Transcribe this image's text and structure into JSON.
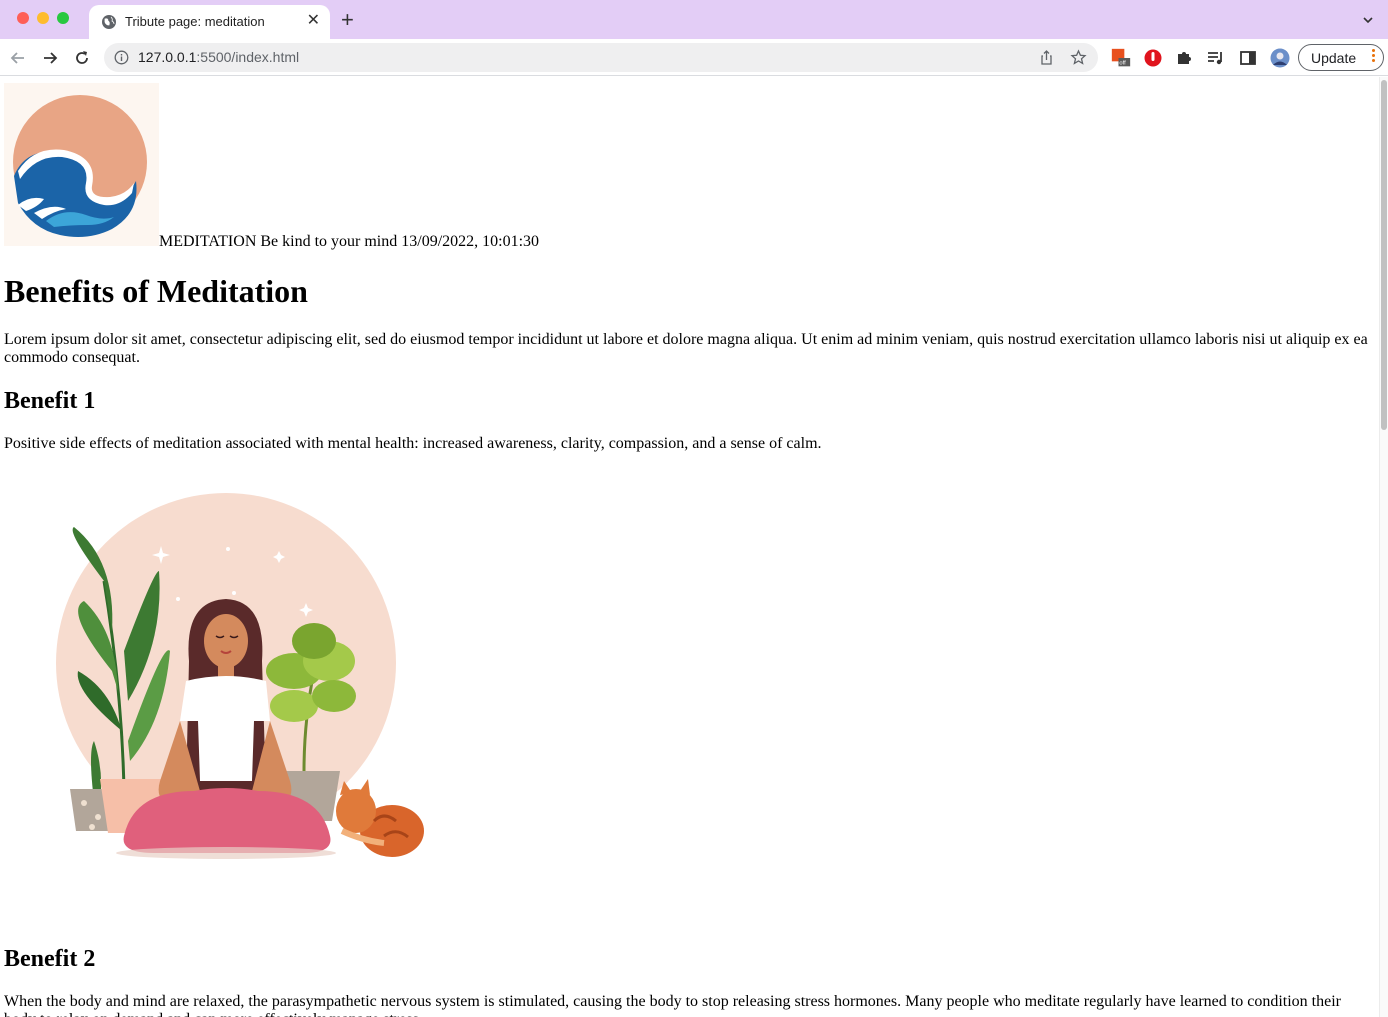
{
  "browser": {
    "tab_title": "Tribute page: meditation",
    "url_host": "127.0.0.1",
    "url_rest": ":5500/index.html",
    "update_label": "Update",
    "extension_badge": "off",
    "accent_color": "#e3cdf6"
  },
  "header": {
    "logo_alt": "meditation logo",
    "text": "MEDITATION Be kind to your mind 13/09/2022, 10:01:30"
  },
  "main": {
    "title": "Benefits of Meditation",
    "intro": "Lorem ipsum dolor sit amet, consectetur adipiscing elit, sed do eiusmod tempor incididunt ut labore et dolore magna aliqua. Ut enim ad minim veniam, quis nostrud exercitation ullamco laboris nisi ut aliquip ex ea commodo consequat.",
    "benefits": [
      {
        "title": "Benefit 1",
        "text": "Positive side effects of meditation associated with mental health: increased awareness, clarity, compassion, and a sense of calm."
      },
      {
        "title": "Benefit 2",
        "text": "When the body and mind are relaxed, the parasympathetic nervous system is stimulated, causing the body to stop releasing stress hormones. Many people who meditate regularly have learned to condition their body to relax on demand and can more effectively manage stress."
      }
    ]
  }
}
